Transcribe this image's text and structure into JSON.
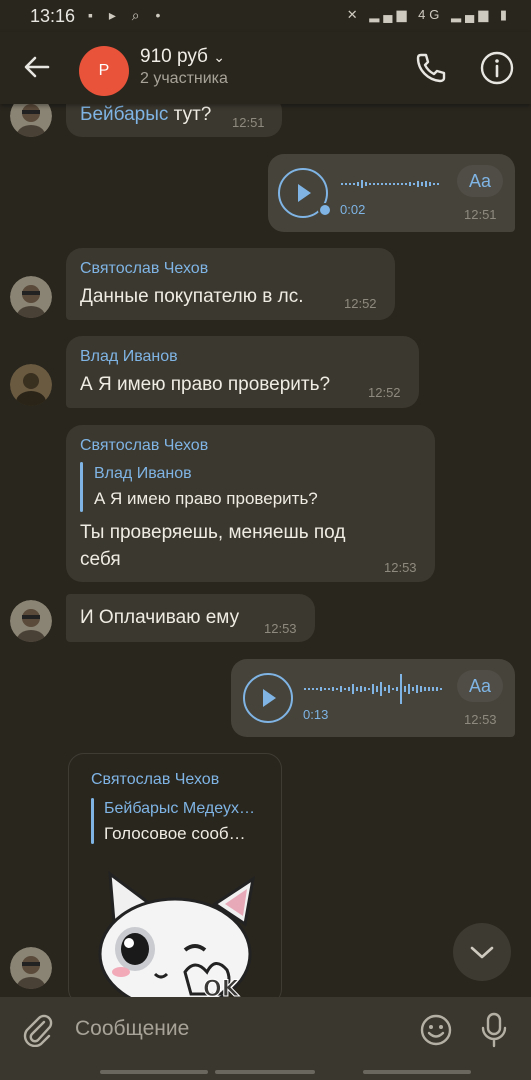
{
  "status_bar": {
    "time": "13:16",
    "left_icons": "▪ ▸ ⌕ •",
    "right_icons": "✕ ▂▄▆ 4G ▂▄▆ ▮"
  },
  "header": {
    "avatar_letter": "Р",
    "title": "910 руб",
    "subtitle": "2 участника",
    "accent": "#e8533a"
  },
  "messages": [
    {
      "type": "text",
      "incoming": true,
      "mention": "Бейбарыс",
      "text": " тут?",
      "time": "12:51"
    },
    {
      "type": "voice",
      "incoming": false,
      "duration": "0:02",
      "aa": "Aa",
      "time": "12:51"
    },
    {
      "type": "text",
      "incoming": true,
      "sender": "Святослав Чехов",
      "text": "Данные покупателю в лс.",
      "time": "12:52"
    },
    {
      "type": "text",
      "incoming": true,
      "sender": "Влад Иванов",
      "text": "А Я имею право проверить?",
      "time": "12:52"
    },
    {
      "type": "reply",
      "incoming": true,
      "sender": "Святослав Чехов",
      "reply_author": "Влад Иванов",
      "reply_text": "А Я имею право проверить?",
      "text_line1": "Ты проверяешь, меняешь под",
      "text_line2": "себя",
      "time": "12:53"
    },
    {
      "type": "text",
      "incoming": true,
      "text": "И Оплачиваю ему",
      "time": "12:53"
    },
    {
      "type": "voice",
      "incoming": false,
      "duration": "0:13",
      "aa": "Aa",
      "time": "12:53"
    },
    {
      "type": "sticker",
      "incoming": true,
      "sender": "Святослав Чехов",
      "reply_author": "Бейбарыс Медеух…",
      "reply_text": "Голосовое сооб…",
      "sticker_caption": "OK"
    }
  ],
  "input": {
    "placeholder": "Сообщение"
  },
  "colors": {
    "background": "#29261e",
    "bubble_in": "#3b382f",
    "bubble_out": "#45433a",
    "link": "#7fb4e4"
  },
  "icons": [
    "back-arrow-icon",
    "phone-icon",
    "info-icon",
    "play-icon",
    "attach-icon",
    "emoji-icon",
    "mic-icon",
    "chevron-down-icon"
  ]
}
